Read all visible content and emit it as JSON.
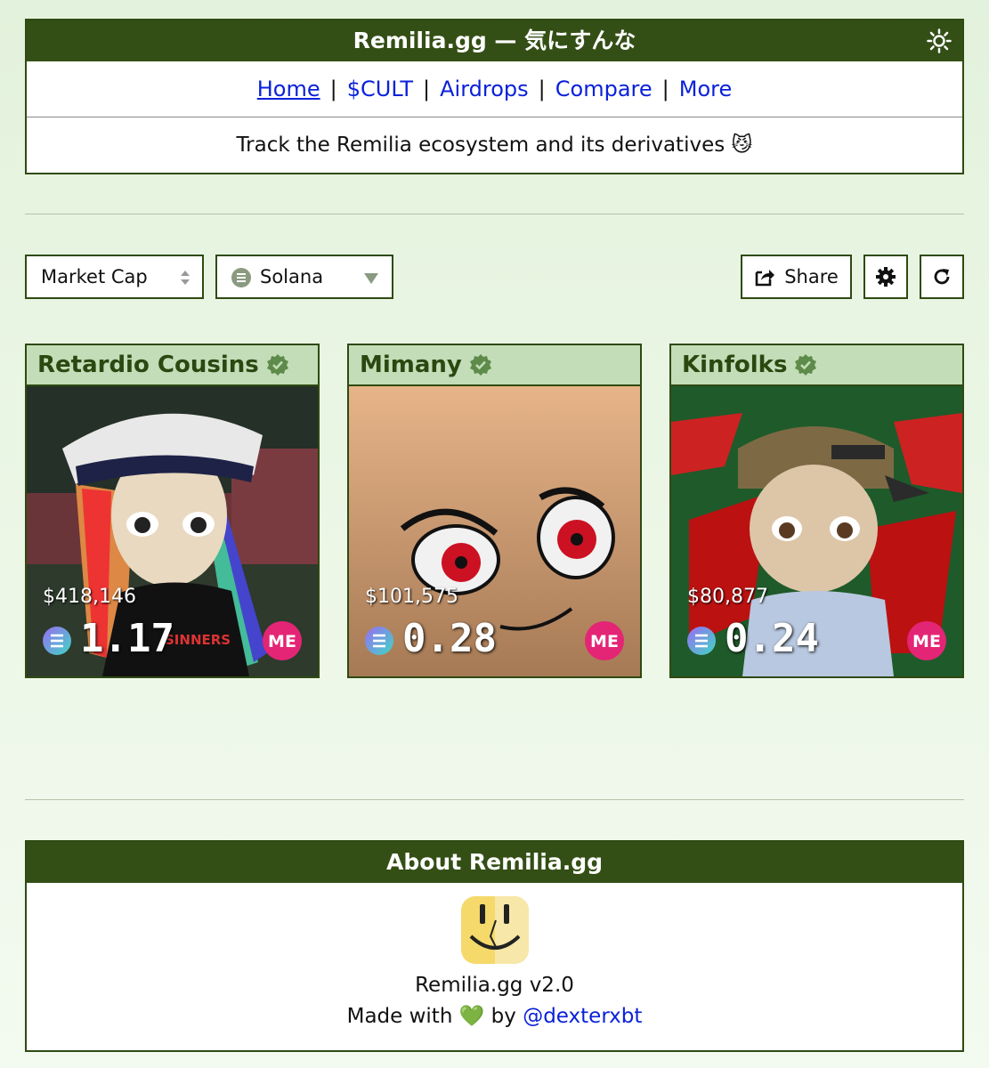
{
  "header": {
    "title": "Remilia.gg — 気にすんな",
    "theme_icon": "sun-icon",
    "nav": [
      {
        "label": "Home",
        "active": true
      },
      {
        "label": "$CULT",
        "active": false
      },
      {
        "label": "Airdrops",
        "active": false
      },
      {
        "label": "Compare",
        "active": false
      },
      {
        "label": "More",
        "active": false
      }
    ],
    "separator": "|",
    "tagline": "Track the Remilia ecosystem and its derivatives 😼"
  },
  "controls": {
    "sort_value": "Market Cap",
    "chain_value": "Solana",
    "share_label": "Share",
    "settings_icon": "gear-icon",
    "refresh_icon": "refresh-icon"
  },
  "cards": [
    {
      "name": "Retardio Cousins",
      "usd": "$418,146",
      "price": "1.17"
    },
    {
      "name": "Mimany",
      "usd": "$101,575",
      "price": "0.28"
    },
    {
      "name": "Kinfolks",
      "usd": "$80,877",
      "price": "0.24"
    }
  ],
  "about": {
    "title": "About Remilia.gg",
    "version": "Remilia.gg v2.0",
    "made_prefix": "Made with 💚 by ",
    "made_link": "@dexterxbt"
  },
  "colors": {
    "accent_dark": "#344f16",
    "card_head": "#c3ddb8",
    "link": "#0a21d9",
    "magic_eden": "#e42575"
  }
}
